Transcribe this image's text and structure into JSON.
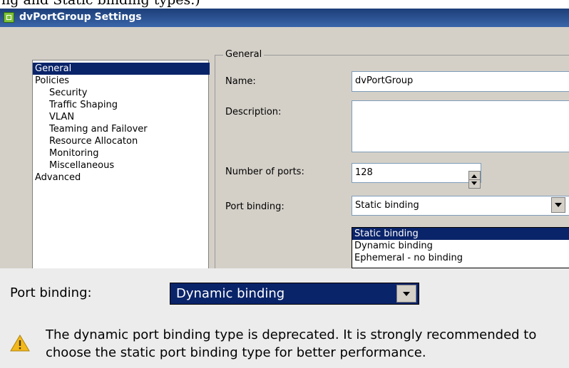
{
  "top_caption": "ng and Static binding types.)",
  "dialog": {
    "title": "dvPortGroup Settings",
    "nav": [
      {
        "label": "General",
        "selected": true
      },
      {
        "label": "Policies",
        "selected": false
      },
      {
        "label": "Security",
        "selected": false
      },
      {
        "label": "Traffic Shaping",
        "selected": false
      },
      {
        "label": "VLAN",
        "selected": false
      },
      {
        "label": "Teaming and Failover",
        "selected": false
      },
      {
        "label": "Resource Allocaton",
        "selected": false
      },
      {
        "label": "Monitoring",
        "selected": false
      },
      {
        "label": "Miscellaneous",
        "selected": false
      },
      {
        "label": "Advanced",
        "selected": false
      }
    ],
    "general": {
      "legend": "General",
      "name_label": "Name:",
      "name_value": "dvPortGroup",
      "description_label": "Description:",
      "description_value": "",
      "ports_label": "Number of ports:",
      "ports_value": "128",
      "binding_label": "Port binding:",
      "binding_value": "Static binding",
      "binding_options": [
        "Static binding",
        "Dynamic binding",
        "Ephemeral - no binding"
      ],
      "binding_highlighted": "Static binding"
    }
  },
  "bottom": {
    "binding_label": "Port binding:",
    "binding_value": "Dynamic binding",
    "warning_text": "The dynamic port binding type is deprecated. It is strongly recommended to choose the static port binding type for better performance."
  },
  "colors": {
    "selection": "#0a246a",
    "dialog_bg": "#d4d0c8",
    "warning_fill": "#f2b81c"
  },
  "icons": {
    "title": "portgroup-icon",
    "warning": "warning-triangle-icon",
    "dropdown": "chevron-down-icon",
    "spinner": "spinner-arrows-icon"
  }
}
